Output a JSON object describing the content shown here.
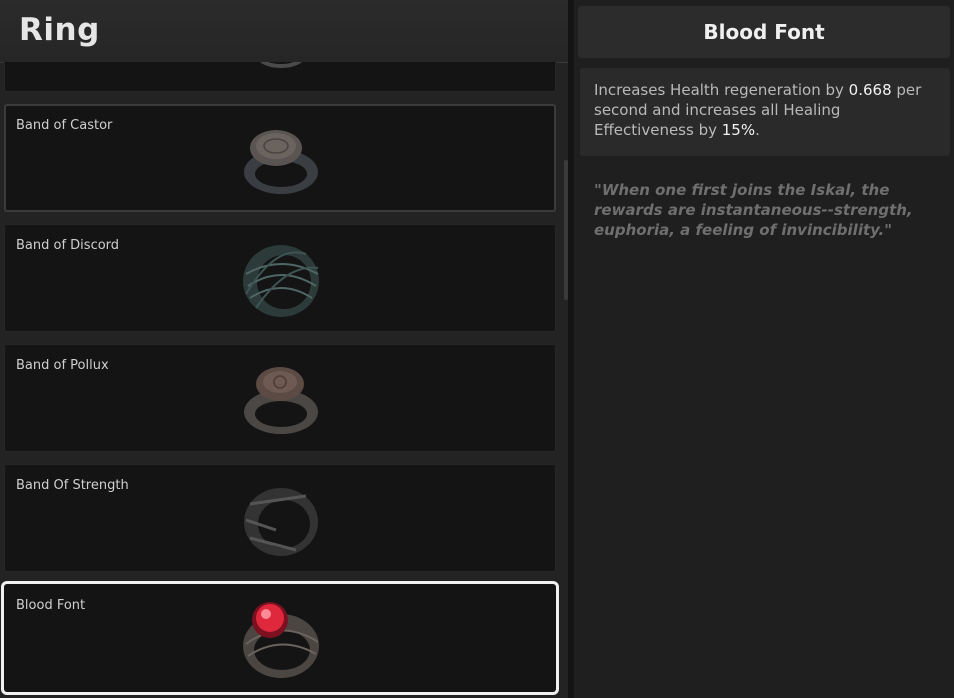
{
  "category_title": "Ring",
  "rings": [
    {
      "name": "Band of Castor",
      "icon": "signet-ring-icon"
    },
    {
      "name": "Band of Discord",
      "icon": "woven-band-ring-icon"
    },
    {
      "name": "Band of Pollux",
      "icon": "signet-ring-icon"
    },
    {
      "name": "Band Of Strength",
      "icon": "wrapped-band-ring-icon"
    },
    {
      "name": "Blood Font",
      "icon": "red-gem-ring-icon"
    }
  ],
  "selected_item": {
    "title": "Blood Font",
    "effect": {
      "part1": "Increases Health regeneration by ",
      "value1": "0.668",
      "part2": " per second and increases all Healing Effectiveness by ",
      "value2": "15%",
      "part3": "."
    },
    "flavor": "\"When one first joins the Iskal, the rewards are instantaneous--strength, euphoria, a feeling of invincibility.\""
  },
  "colors": {
    "selected_outline": "#f1f1f1",
    "gem": "#e0283c"
  }
}
